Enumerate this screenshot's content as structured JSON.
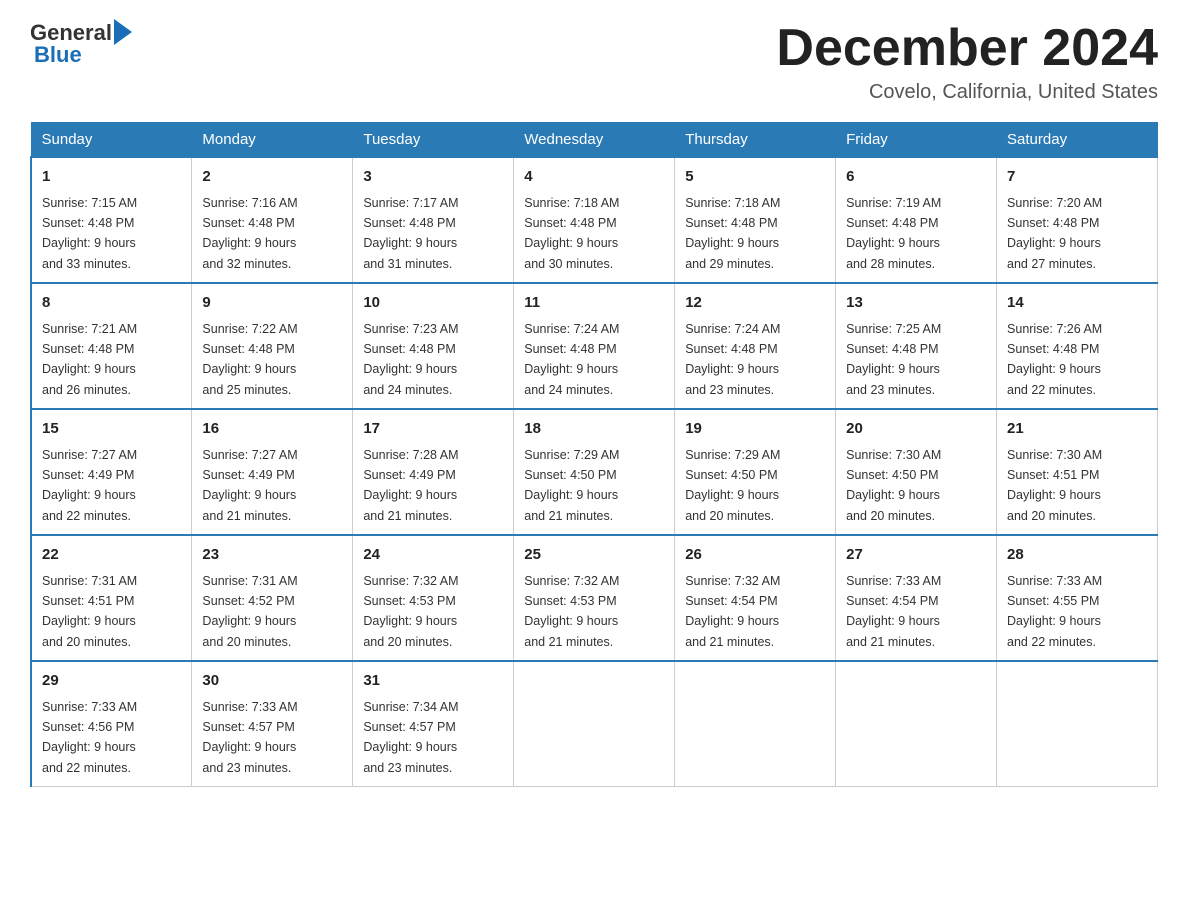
{
  "header": {
    "logo_general": "General",
    "logo_blue": "Blue",
    "month_title": "December 2024",
    "location": "Covelo, California, United States"
  },
  "days_of_week": [
    "Sunday",
    "Monday",
    "Tuesday",
    "Wednesday",
    "Thursday",
    "Friday",
    "Saturday"
  ],
  "weeks": [
    [
      {
        "day": "1",
        "sunrise": "7:15 AM",
        "sunset": "4:48 PM",
        "daylight": "9 hours and 33 minutes."
      },
      {
        "day": "2",
        "sunrise": "7:16 AM",
        "sunset": "4:48 PM",
        "daylight": "9 hours and 32 minutes."
      },
      {
        "day": "3",
        "sunrise": "7:17 AM",
        "sunset": "4:48 PM",
        "daylight": "9 hours and 31 minutes."
      },
      {
        "day": "4",
        "sunrise": "7:18 AM",
        "sunset": "4:48 PM",
        "daylight": "9 hours and 30 minutes."
      },
      {
        "day": "5",
        "sunrise": "7:18 AM",
        "sunset": "4:48 PM",
        "daylight": "9 hours and 29 minutes."
      },
      {
        "day": "6",
        "sunrise": "7:19 AM",
        "sunset": "4:48 PM",
        "daylight": "9 hours and 28 minutes."
      },
      {
        "day": "7",
        "sunrise": "7:20 AM",
        "sunset": "4:48 PM",
        "daylight": "9 hours and 27 minutes."
      }
    ],
    [
      {
        "day": "8",
        "sunrise": "7:21 AM",
        "sunset": "4:48 PM",
        "daylight": "9 hours and 26 minutes."
      },
      {
        "day": "9",
        "sunrise": "7:22 AM",
        "sunset": "4:48 PM",
        "daylight": "9 hours and 25 minutes."
      },
      {
        "day": "10",
        "sunrise": "7:23 AM",
        "sunset": "4:48 PM",
        "daylight": "9 hours and 24 minutes."
      },
      {
        "day": "11",
        "sunrise": "7:24 AM",
        "sunset": "4:48 PM",
        "daylight": "9 hours and 24 minutes."
      },
      {
        "day": "12",
        "sunrise": "7:24 AM",
        "sunset": "4:48 PM",
        "daylight": "9 hours and 23 minutes."
      },
      {
        "day": "13",
        "sunrise": "7:25 AM",
        "sunset": "4:48 PM",
        "daylight": "9 hours and 23 minutes."
      },
      {
        "day": "14",
        "sunrise": "7:26 AM",
        "sunset": "4:48 PM",
        "daylight": "9 hours and 22 minutes."
      }
    ],
    [
      {
        "day": "15",
        "sunrise": "7:27 AM",
        "sunset": "4:49 PM",
        "daylight": "9 hours and 22 minutes."
      },
      {
        "day": "16",
        "sunrise": "7:27 AM",
        "sunset": "4:49 PM",
        "daylight": "9 hours and 21 minutes."
      },
      {
        "day": "17",
        "sunrise": "7:28 AM",
        "sunset": "4:49 PM",
        "daylight": "9 hours and 21 minutes."
      },
      {
        "day": "18",
        "sunrise": "7:29 AM",
        "sunset": "4:50 PM",
        "daylight": "9 hours and 21 minutes."
      },
      {
        "day": "19",
        "sunrise": "7:29 AM",
        "sunset": "4:50 PM",
        "daylight": "9 hours and 20 minutes."
      },
      {
        "day": "20",
        "sunrise": "7:30 AM",
        "sunset": "4:50 PM",
        "daylight": "9 hours and 20 minutes."
      },
      {
        "day": "21",
        "sunrise": "7:30 AM",
        "sunset": "4:51 PM",
        "daylight": "9 hours and 20 minutes."
      }
    ],
    [
      {
        "day": "22",
        "sunrise": "7:31 AM",
        "sunset": "4:51 PM",
        "daylight": "9 hours and 20 minutes."
      },
      {
        "day": "23",
        "sunrise": "7:31 AM",
        "sunset": "4:52 PM",
        "daylight": "9 hours and 20 minutes."
      },
      {
        "day": "24",
        "sunrise": "7:32 AM",
        "sunset": "4:53 PM",
        "daylight": "9 hours and 20 minutes."
      },
      {
        "day": "25",
        "sunrise": "7:32 AM",
        "sunset": "4:53 PM",
        "daylight": "9 hours and 21 minutes."
      },
      {
        "day": "26",
        "sunrise": "7:32 AM",
        "sunset": "4:54 PM",
        "daylight": "9 hours and 21 minutes."
      },
      {
        "day": "27",
        "sunrise": "7:33 AM",
        "sunset": "4:54 PM",
        "daylight": "9 hours and 21 minutes."
      },
      {
        "day": "28",
        "sunrise": "7:33 AM",
        "sunset": "4:55 PM",
        "daylight": "9 hours and 22 minutes."
      }
    ],
    [
      {
        "day": "29",
        "sunrise": "7:33 AM",
        "sunset": "4:56 PM",
        "daylight": "9 hours and 22 minutes."
      },
      {
        "day": "30",
        "sunrise": "7:33 AM",
        "sunset": "4:57 PM",
        "daylight": "9 hours and 23 minutes."
      },
      {
        "day": "31",
        "sunrise": "7:34 AM",
        "sunset": "4:57 PM",
        "daylight": "9 hours and 23 minutes."
      },
      null,
      null,
      null,
      null
    ]
  ],
  "labels": {
    "sunrise": "Sunrise:",
    "sunset": "Sunset:",
    "daylight": "Daylight:"
  }
}
